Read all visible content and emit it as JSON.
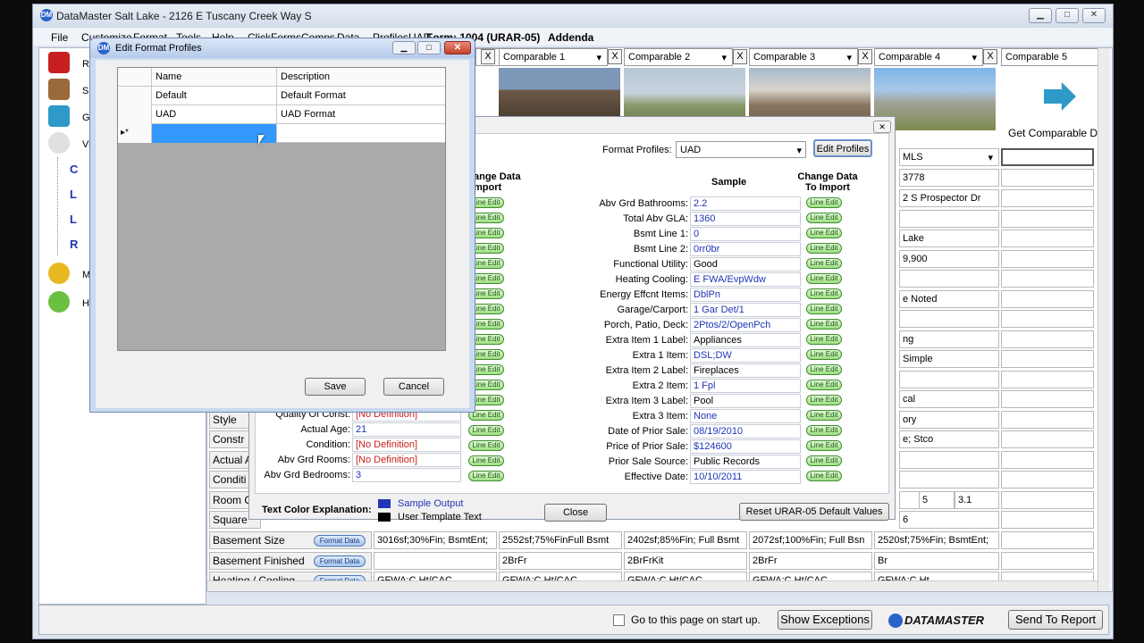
{
  "app": {
    "title": "DataMaster Salt Lake - 2126 E Tuscany Creek Way S",
    "icon_label": "DM"
  },
  "window_controls": {
    "min": "▁",
    "max": "□",
    "close": "✕"
  },
  "menu": [
    "File",
    "Customize",
    "Format",
    "Tools",
    "Help",
    "ClickForms",
    "Comps",
    "Data",
    "Profiles",
    "UAD",
    "Form: 1004 (URAR-05)",
    "Addenda"
  ],
  "left_panel": {
    "items": [
      "Rep",
      "Sub",
      "Get",
      "View",
      "C",
      "L",
      "L",
      "R",
      "Map",
      "Help"
    ]
  },
  "comparables": [
    {
      "label": "",
      "has_photo": false
    },
    {
      "label": "Comparable 1",
      "has_photo": true,
      "colors": [
        "#7d98b8",
        "#6f5a4a",
        "#3c3a34"
      ]
    },
    {
      "label": "Comparable 2",
      "has_photo": true,
      "colors": [
        "#b8c7d6",
        "#8a9a6a",
        "#5b6b3a"
      ]
    },
    {
      "label": "Comparable 3",
      "has_photo": true,
      "colors": [
        "#a8b9cc",
        "#d7d4cc",
        "#6b5a48"
      ]
    },
    {
      "label": "Comparable 4",
      "has_photo": true,
      "colors": [
        "#7fb4e8",
        "#a2a39a",
        "#7c8a4c"
      ]
    },
    {
      "label": "Comparable 5",
      "has_photo": false,
      "get_text": "Get Comparable D"
    }
  ],
  "comp4_visible": [
    "MLS",
    "3778",
    "2 S Prospector Dr",
    "",
    "Lake",
    "9,900",
    "",
    "e Noted",
    "",
    "ng",
    "Simple",
    "",
    "cal",
    "ory",
    "e; Stco",
    "",
    ""
  ],
  "comp4_rooms": [
    "5",
    "3.1"
  ],
  "comp4_sqft": "6",
  "rows": [
    {
      "label": "Style"
    },
    {
      "label": "Constr"
    },
    {
      "label": "Actual A"
    },
    {
      "label": "Conditi"
    },
    {
      "label": "Room C"
    },
    {
      "label": "Square"
    },
    {
      "label": "Basement Size",
      "fmt": "Format Data",
      "values": [
        "3016sf;30%Fin; BsmtEnt;",
        "2552sf;75%FinFull Bsmt",
        "2402sf;85%Fin; Full Bsmt",
        "2072sf;100%Fin; Full Bsn",
        "2520sf;75%Fin; BsmtEnt;"
      ]
    },
    {
      "label": "Basement Finished",
      "fmt": "Format Data",
      "values": [
        "",
        "2BrFr",
        "2BrFrKit",
        "2BrFr",
        "Br"
      ]
    },
    {
      "label": "Heating / Cooling",
      "fmt": "Format Data",
      "values": [
        "GFWA;C Ht/CAC",
        "GFWA;C Ht/CAC",
        "GFWA;C Ht/CAC",
        "GFWA;C Ht/CAC",
        "GFWA;C Ht"
      ]
    }
  ],
  "format_dialog": {
    "close_x": "✕",
    "profiles_label": "Format Profiles:",
    "profile_value": "UAD",
    "edit_profiles": "Edit Profiles",
    "left_header": "ange Data\nmport",
    "sample_header": "Sample",
    "change_header": "Change Data\nTo Import",
    "line_edit": "Line Edit",
    "left_rows": [
      {
        "label": "Quality Of Const:",
        "value": "[No Definition]",
        "red": true
      },
      {
        "label": "Actual Age:",
        "value": "21",
        "red": false
      },
      {
        "label": "Condition:",
        "value": "[No Definition]",
        "red": true
      },
      {
        "label": "Abv Grd Rooms:",
        "value": "[No Definition]",
        "red": true
      },
      {
        "label": "Abv Grd Bedrooms:",
        "value": "3",
        "red": false
      }
    ],
    "right_rows": [
      {
        "label": "Abv Grd Bathrooms:",
        "value": "2.2"
      },
      {
        "label": "Total Abv GLA:",
        "value": "1360"
      },
      {
        "label": "Bsmt Line 1:",
        "value": "0"
      },
      {
        "label": "Bsmt Line 2:",
        "value": "0rr0br"
      },
      {
        "label": "Functional Utility:",
        "value": "Good"
      },
      {
        "label": "Heating Cooling:",
        "value": "E FWA/EvpWdw"
      },
      {
        "label": "Energy Effcnt Items:",
        "value": "DblPn"
      },
      {
        "label": "Garage/Carport:",
        "value": "1 Gar Det/1"
      },
      {
        "label": "Porch, Patio, Deck:",
        "value": "2Ptos/2/OpenPch"
      },
      {
        "label": "Extra Item 1 Label:",
        "value": "Appliances"
      },
      {
        "label": "Extra 1 Item:",
        "value": "DSL;DW"
      },
      {
        "label": "Extra Item 2 Label:",
        "value": "Fireplaces"
      },
      {
        "label": "Extra 2 Item:",
        "value": "1 Fpl"
      },
      {
        "label": "Extra Item 3 Label:",
        "value": "Pool"
      },
      {
        "label": "Extra 3 Item:",
        "value": "None"
      },
      {
        "label": "Date of Prior Sale:",
        "value": "08/19/2010"
      },
      {
        "label": "Price of Prior Sale:",
        "value": "$124600"
      },
      {
        "label": "Prior Sale Source:",
        "value": "Public Records"
      },
      {
        "label": "Effective Date:",
        "value": "10/10/2011"
      }
    ],
    "color_title": "Text Color Explanation:",
    "sample_output": "Sample Output",
    "user_template": "User Template Text",
    "close_btn": "Close",
    "reset_btn": "Reset URAR-05 Default Values",
    "colors": {
      "sample": "#1f35b5",
      "template": "#000000"
    }
  },
  "profiles_dialog": {
    "title": "Edit Format Profiles",
    "col_name": "Name",
    "col_desc": "Description",
    "rows": [
      {
        "name": "Default",
        "desc": "Default Format"
      },
      {
        "name": "UAD",
        "desc": "UAD Format"
      }
    ],
    "new_row_marker": "▸*",
    "save": "Save",
    "cancel": "Cancel"
  },
  "bottom": {
    "startup": "Go to this page on start up.",
    "show_exceptions": "Show Exceptions",
    "brand": "DATAMASTER",
    "send": "Send To Report"
  }
}
